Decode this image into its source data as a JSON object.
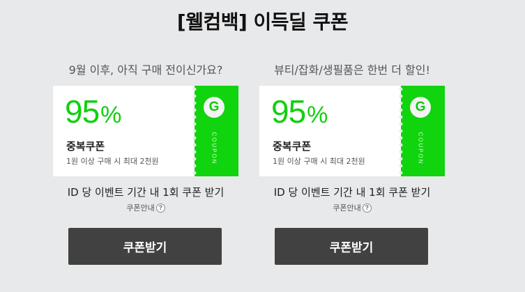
{
  "page": {
    "title": "[웰컴백] 이득딜 쿠폰"
  },
  "coupons": [
    {
      "subtitle": "9월 이후, 아직 구매 전이신가요?",
      "percent": "95",
      "percent_symbol": "%",
      "type": "중복쿠폰",
      "description": "1원 이상 구매 시 최대 2천원",
      "logo_letter": "G",
      "side_label": "COUPON",
      "limit_text": "ID 당 이벤트 기간 내 1회 쿠폰 받기",
      "info_label": "쿠폰안내",
      "info_icon": "?",
      "button_label": "쿠폰받기"
    },
    {
      "subtitle": "뷰티/잡화/생필품은 한번 더 할인!",
      "percent": "95",
      "percent_symbol": "%",
      "type": "중복쿠폰",
      "description": "1원 이상 구매 시 최대 2천원",
      "logo_letter": "G",
      "side_label": "COUPON",
      "limit_text": "ID 당 이벤트 기간 내 1회 쿠폰 받기",
      "info_label": "쿠폰안내",
      "info_icon": "?",
      "button_label": "쿠폰받기"
    }
  ],
  "colors": {
    "background": "#e8e9eb",
    "accent_green": "#10d40e",
    "button_bg": "#414141",
    "button_text": "#ffffff"
  }
}
